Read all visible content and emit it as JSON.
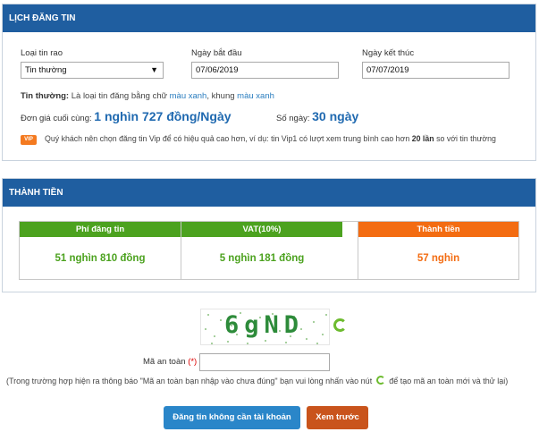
{
  "schedule": {
    "title": "LỊCH ĐĂNG TIN",
    "post_type_label": "Loại tin rao",
    "post_type_value": "Tin thường",
    "start_label": "Ngày bắt đầu",
    "start_value": "07/06/2019",
    "end_label": "Ngày kết thúc",
    "end_value": "07/07/2019",
    "note_prefix": "Tin thường:",
    "note_text1": " Là loại tin đăng bằng chữ ",
    "note_color1": "màu xanh",
    "note_text2": ", khung ",
    "note_color2": "màu xanh",
    "unit_price_label": "Đơn giá cuối cùng:",
    "unit_price_value": "1 nghìn 727 đồng/Ngày",
    "days_label": "Số ngày:",
    "days_value": "30 ngày",
    "vip_badge": "VIP",
    "vip_note_1": "Quý khách nên chọn đăng tin Vip để có hiệu quả cao hơn, ví dụ: tin Vip1 có lượt xem trung bình cao hơn ",
    "vip_note_bold": "20 lần",
    "vip_note_2": " so với tin thường"
  },
  "total": {
    "title": "THÀNH TIỀN",
    "columns": [
      {
        "header": "Phí đăng tin",
        "value": "51 nghìn 810 đồng"
      },
      {
        "header": "VAT(10%)",
        "value": "5 nghìn 181 đồng"
      },
      {
        "header": "Thành tiền",
        "value": "57 nghìn"
      }
    ]
  },
  "captcha": {
    "text": "6gND",
    "label": "Mã an toàn",
    "required_mark": "(*)",
    "value": "",
    "note_1": "(Trong trường hợp hiện ra thông báo \"Mã an toàn bạn nhập vào chưa đúng\" bạn vui lòng nhấn vào nút",
    "note_2": "để tạo mã an toàn mới và thử lại)"
  },
  "actions": {
    "post_label": "Đăng tin không cần tài khoản",
    "preview_label": "Xem trước"
  },
  "colors": {
    "header_blue": "#1f5ea0",
    "green": "#4ca21f",
    "orange": "#f36c12",
    "price_blue": "#1f69b0"
  }
}
